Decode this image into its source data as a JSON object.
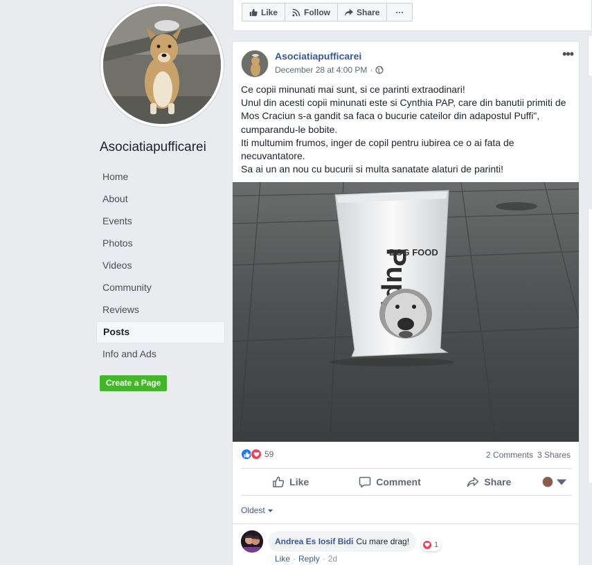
{
  "page": {
    "name": "Asociatiapufficarei"
  },
  "sidebar": {
    "items": [
      {
        "label": "Home"
      },
      {
        "label": "About"
      },
      {
        "label": "Events"
      },
      {
        "label": "Photos"
      },
      {
        "label": "Videos"
      },
      {
        "label": "Community"
      },
      {
        "label": "Reviews"
      },
      {
        "label": "Posts",
        "active": true
      },
      {
        "label": "Info and Ads"
      }
    ],
    "create_page_label": "Create a Page"
  },
  "topbar": {
    "like_label": "Like",
    "follow_label": "Follow",
    "share_label": "Share",
    "more_label": "···"
  },
  "post": {
    "author": "Asociatiapufficarei",
    "timestamp": "December 28 at 4:00 PM",
    "audience_icon": "globe-icon",
    "text_lines": [
      "Ce copii minunati mai sunt, si ce parinti extraodinari!",
      "Unul din acesti copii minunati este si Cynthia PAP, care din banutii primiti de Mos Craciun s-a gandit sa faca o bucurie cateilor din adapostul Puffi\", cumparandu-le bobite.",
      "Iti multumim frumos, inger de copil pentru iubirea ce o ai fata de necuvantatore.",
      "Sa ai un an nou cu bucurii si multa sanatate alaturi de parinti!"
    ],
    "image": {
      "bag_label": "DOG FOOD",
      "bag_brand": "Puppy"
    },
    "reactions_count": "59",
    "comments_count": "2 Comments",
    "shares_count": "3 Shares",
    "actions": {
      "like": "Like",
      "comment": "Comment",
      "share": "Share"
    },
    "sort_label": "Oldest"
  },
  "comment": {
    "author": "Andrea Es Iosif Bidi",
    "text": "Cu mare drag!",
    "reaction_count": "1",
    "like_label": "Like",
    "reply_label": "Reply",
    "time": "2d"
  },
  "colors": {
    "link": "#365899",
    "create_page_green": "#42b72a",
    "like_blue": "#2078f4",
    "love_red": "#f33e58",
    "page_bg": "#e9ebee"
  }
}
